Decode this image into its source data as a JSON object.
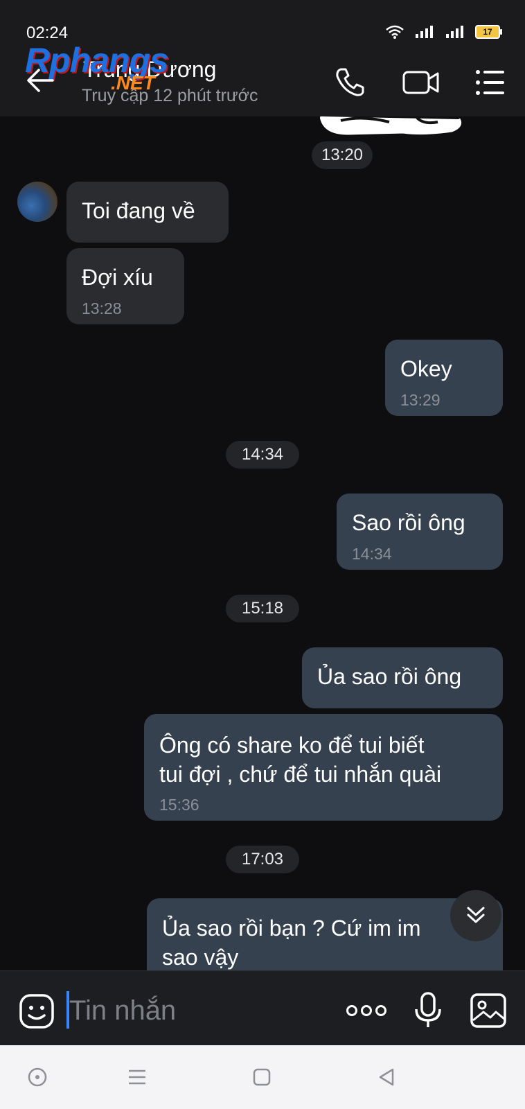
{
  "status_bar": {
    "time": "02:24",
    "battery": "17"
  },
  "header": {
    "contact_name": "Trung Dương",
    "contact_status": "Truy cập 12 phút trước",
    "watermark": "Rphangs",
    "watermark_suffix": ".NET"
  },
  "chat": {
    "separators": [
      "13:20",
      "14:34",
      "15:18",
      "17:03"
    ],
    "messages": [
      {
        "direction": "in",
        "text": "Toi đang về",
        "time": ""
      },
      {
        "direction": "in",
        "text": "Đợi xíu",
        "time": "13:28"
      },
      {
        "direction": "out",
        "text": "Okey",
        "time": "13:29"
      },
      {
        "direction": "out",
        "text": "Sao rồi ông",
        "time": "14:34"
      },
      {
        "direction": "out",
        "text": "Ủa sao rồi ông",
        "time": ""
      },
      {
        "direction": "out",
        "text": "Ông có share ko để tui biết\ntui đợi , chứ để tui nhắn quài",
        "time": "15:36"
      },
      {
        "direction": "out",
        "text": "Ủa sao rồi bạn ? Cứ im im\nsao vậy",
        "time": ""
      }
    ]
  },
  "composer": {
    "placeholder": "Tin nhắn"
  },
  "icons": {
    "back": "back-arrow-icon",
    "call": "phone-icon",
    "video": "video-camera-icon",
    "menu": "list-menu-icon",
    "sticker": "emoji-sticker-icon",
    "more": "more-dots-icon",
    "mic": "microphone-icon",
    "image": "image-icon",
    "scroll": "chevron-double-down-icon"
  },
  "colors": {
    "background": "#0e0e10",
    "incoming_bubble": "#2b2c2f",
    "outgoing_bubble": "#36414f",
    "cursor": "#3a86ff"
  }
}
